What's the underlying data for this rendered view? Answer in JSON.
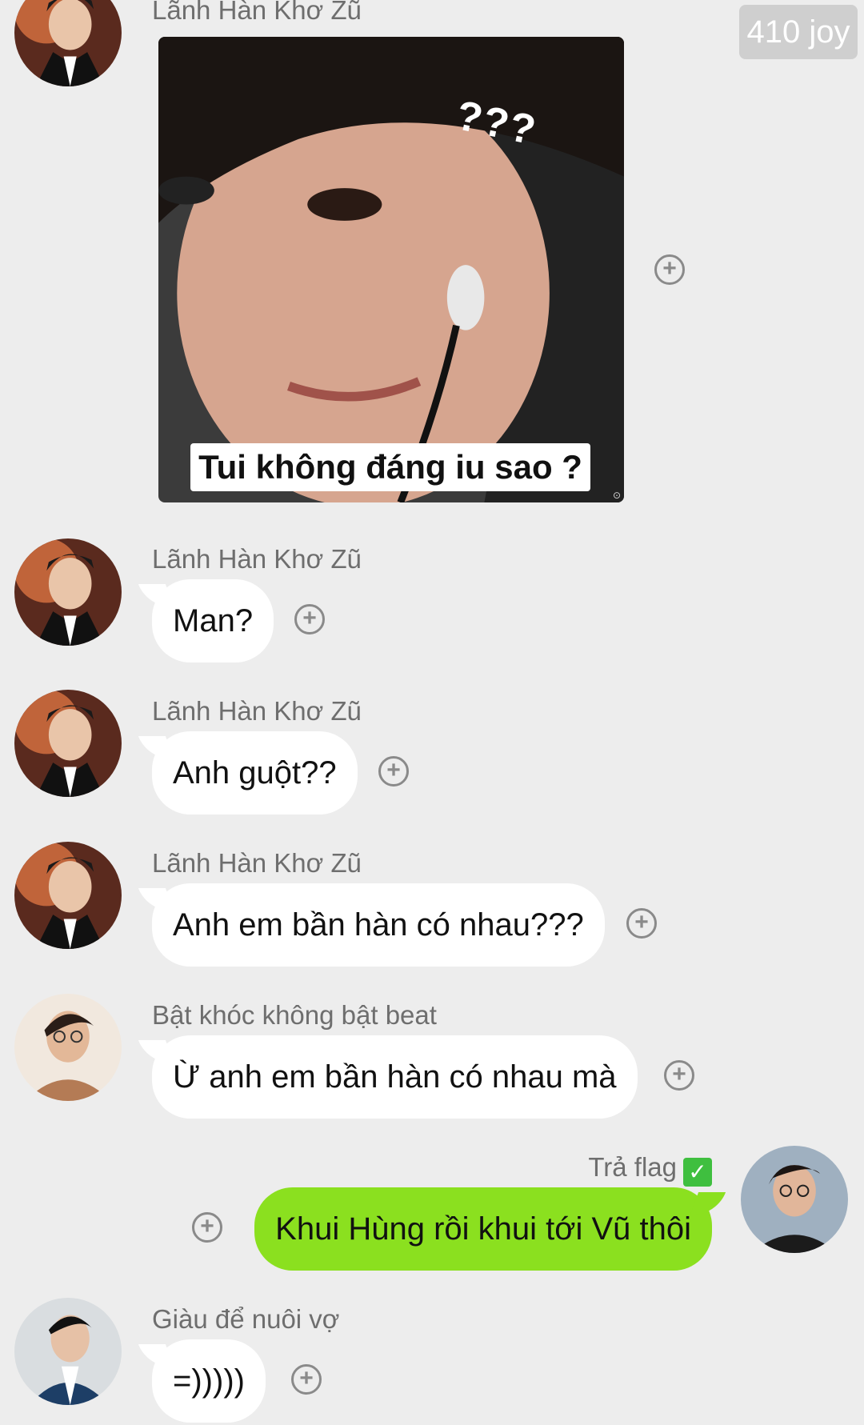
{
  "badge": "410 joy",
  "meme": {
    "caption": "Tui không đáng iu sao ?",
    "marks": "???"
  },
  "messages": [
    {
      "sender": "Lãnh Hàn Khơ Zũ",
      "text": "Man?"
    },
    {
      "sender": "Lãnh Hàn Khơ Zũ",
      "text": "Anh guột??"
    },
    {
      "sender": "Lãnh Hàn Khơ Zũ",
      "text": "Anh em bần hàn có nhau???"
    },
    {
      "sender": "Bật khóc không bật beat",
      "text": "Ừ anh em bần hàn có nhau mà"
    },
    {
      "sender": "Trả flag",
      "text": "Khui Hùng rồi khui tới Vũ thôi",
      "check": "✓"
    },
    {
      "sender": "Giàu để nuôi vợ",
      "text": "=)))))"
    }
  ],
  "first_sender": "Lãnh Hàn Khơ Zũ",
  "react_symbol": "+",
  "colors": {
    "background": "#ededed",
    "own_bubble": "#8be01f",
    "bubble": "#ffffff"
  },
  "icons": [
    "add-reaction-icon",
    "check-mark-icon"
  ]
}
